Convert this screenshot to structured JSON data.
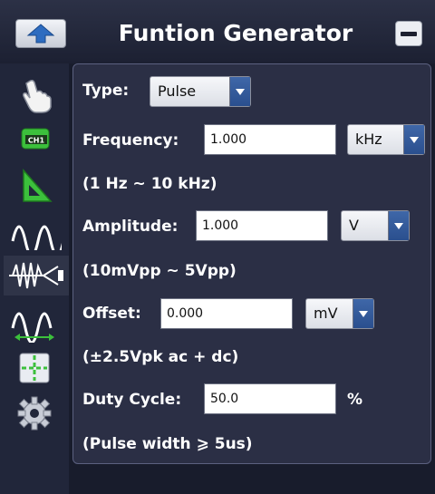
{
  "window": {
    "title": "Funtion Generator"
  },
  "sidebar": {
    "items": [
      {
        "icon": "hand-pointer-icon"
      },
      {
        "icon": "ch1-channel-icon",
        "label": "CH1"
      },
      {
        "icon": "ruler-triangle-icon"
      },
      {
        "icon": "sine-wave-icon"
      },
      {
        "icon": "burst-wave-icon",
        "active": true
      },
      {
        "icon": "wave-measure-icon"
      },
      {
        "icon": "cursor-crosshair-icon"
      },
      {
        "icon": "gear-icon"
      }
    ]
  },
  "form": {
    "type_label": "Type:",
    "type_value": "Pulse",
    "frequency_label": "Frequency:",
    "frequency_value": "1.000",
    "frequency_unit": "kHz",
    "frequency_range": "(1 Hz ~ 10 kHz)",
    "amplitude_label": "Amplitude:",
    "amplitude_value": "1.000",
    "amplitude_unit": "V",
    "amplitude_range": "(10mVpp ~ 5Vpp)",
    "offset_label": "Offset:",
    "offset_value": "0.000",
    "offset_unit": "mV",
    "offset_range": "(±2.5Vpk ac + dc)",
    "duty_label": "Duty Cycle:",
    "duty_value": "50.0",
    "duty_unit": "%",
    "pulse_note": "(Pulse width ⩾ 5us)"
  },
  "colors": {
    "background": "#181c2c",
    "panel": "#2b2f45",
    "accent_blue": "#2a4f8e",
    "icon_green": "#3cc03c"
  }
}
